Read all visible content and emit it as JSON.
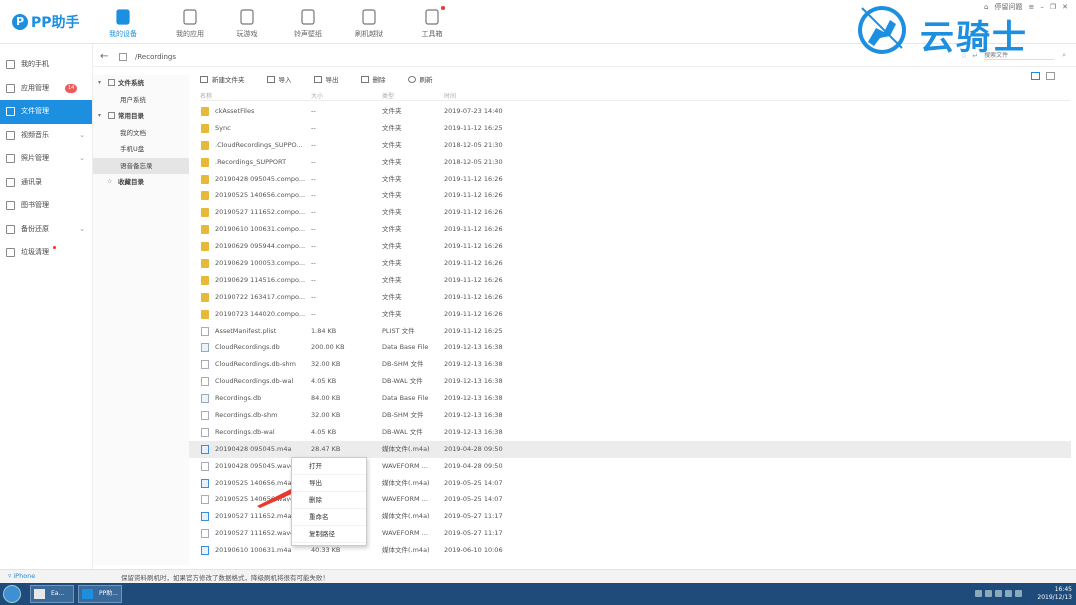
{
  "app": {
    "name": "PP助手"
  },
  "top_nav": [
    {
      "label": "我的设备",
      "icon": "device-icon",
      "active": true
    },
    {
      "label": "我的应用",
      "icon": "apps-icon",
      "active": false
    },
    {
      "label": "玩游戏",
      "icon": "gamepad-icon",
      "active": false
    },
    {
      "label": "铃声壁纸",
      "icon": "ringtone-icon",
      "active": false
    },
    {
      "label": "刷机越狱",
      "icon": "refresh-icon",
      "active": false
    },
    {
      "label": "工具箱",
      "icon": "toolbox-icon",
      "active": false,
      "dot": true
    }
  ],
  "window_controls": {
    "feedback": "停留问题"
  },
  "watermark": {
    "text": "云骑士"
  },
  "sidebar": [
    {
      "label": "我的手机",
      "icon": "phone-icon"
    },
    {
      "label": "应用管理",
      "icon": "app-icon",
      "badge": "14"
    },
    {
      "label": "文件管理",
      "icon": "file-icon",
      "active": true
    },
    {
      "label": "视频音乐",
      "icon": "video-icon",
      "chevron": true
    },
    {
      "label": "照片管理",
      "icon": "photo-icon",
      "chevron": true
    },
    {
      "label": "通讯录",
      "icon": "contacts-icon"
    },
    {
      "label": "图书管理",
      "icon": "book-icon"
    },
    {
      "label": "备份还原",
      "icon": "backup-icon",
      "chevron": true
    },
    {
      "label": "垃圾清理",
      "icon": "trash-icon",
      "dot": true
    }
  ],
  "path": {
    "current": "/Recordings",
    "search_placeholder": "搜索文件"
  },
  "tree": [
    {
      "label": "文件系统",
      "level": 0,
      "twisty": "▾"
    },
    {
      "label": "用户系统",
      "level": 1
    },
    {
      "label": "常用目录",
      "level": 0,
      "twisty": "▾"
    },
    {
      "label": "我的文档",
      "level": 1
    },
    {
      "label": "手机U盘",
      "level": 1
    },
    {
      "label": "语音备忘录",
      "level": 1,
      "active": true
    },
    {
      "label": "收藏目录",
      "level": 0,
      "star": true
    }
  ],
  "toolbar": {
    "new_folder": "新建文件夹",
    "import": "导入",
    "export": "导出",
    "delete": "删除",
    "refresh": "刷新"
  },
  "columns": {
    "name": "名称",
    "size": "大小",
    "type": "类型",
    "time": "时间"
  },
  "files": [
    {
      "name": "ckAssetFiles",
      "size": "--",
      "type": "文件夹",
      "time": "2019-07-23 14:40",
      "icon": "folder"
    },
    {
      "name": "Sync",
      "size": "--",
      "type": "文件夹",
      "time": "2019-11-12 16:25",
      "icon": "folder"
    },
    {
      "name": ".CloudRecordings_SUPPO...",
      "size": "--",
      "type": "文件夹",
      "time": "2018-12-05 21:30",
      "icon": "folder"
    },
    {
      "name": ".Recordings_SUPPORT",
      "size": "--",
      "type": "文件夹",
      "time": "2018-12-05 21:30",
      "icon": "folder"
    },
    {
      "name": "20190428 095045.compo...",
      "size": "--",
      "type": "文件夹",
      "time": "2019-11-12 16:26",
      "icon": "folder"
    },
    {
      "name": "20190525 140656.compo...",
      "size": "--",
      "type": "文件夹",
      "time": "2019-11-12 16:26",
      "icon": "folder"
    },
    {
      "name": "20190527 111652.compo...",
      "size": "--",
      "type": "文件夹",
      "time": "2019-11-12 16:26",
      "icon": "folder"
    },
    {
      "name": "20190610 100631.compo...",
      "size": "--",
      "type": "文件夹",
      "time": "2019-11-12 16:26",
      "icon": "folder"
    },
    {
      "name": "20190629 095944.compo...",
      "size": "--",
      "type": "文件夹",
      "time": "2019-11-12 16:26",
      "icon": "folder"
    },
    {
      "name": "20190629 100053.compo...",
      "size": "--",
      "type": "文件夹",
      "time": "2019-11-12 16:26",
      "icon": "folder"
    },
    {
      "name": "20190629 114516.compo...",
      "size": "--",
      "type": "文件夹",
      "time": "2019-11-12 16:26",
      "icon": "folder"
    },
    {
      "name": "20190722 163417.compo...",
      "size": "--",
      "type": "文件夹",
      "time": "2019-11-12 16:26",
      "icon": "folder"
    },
    {
      "name": "20190723 144020.compo...",
      "size": "--",
      "type": "文件夹",
      "time": "2019-11-12 16:26",
      "icon": "folder"
    },
    {
      "name": "AssetManifest.plist",
      "size": "1.84 KB",
      "type": "PLIST 文件",
      "time": "2019-11-12 16:25",
      "icon": "file"
    },
    {
      "name": "CloudRecordings.db",
      "size": "200.00 KB",
      "type": "Data Base File",
      "time": "2019-12-13 16:38",
      "icon": "db"
    },
    {
      "name": "CloudRecordings.db-shm",
      "size": "32.00 KB",
      "type": "DB-SHM 文件",
      "time": "2019-12-13 16:38",
      "icon": "file"
    },
    {
      "name": "CloudRecordings.db-wal",
      "size": "4.05 KB",
      "type": "DB-WAL 文件",
      "time": "2019-12-13 16:38",
      "icon": "file"
    },
    {
      "name": "Recordings.db",
      "size": "84.00 KB",
      "type": "Data Base File",
      "time": "2019-12-13 16:38",
      "icon": "db"
    },
    {
      "name": "Recordings.db-shm",
      "size": "32.00 KB",
      "type": "DB-SHM 文件",
      "time": "2019-12-13 16:38",
      "icon": "file"
    },
    {
      "name": "Recordings.db-wal",
      "size": "4.05 KB",
      "type": "DB-WAL 文件",
      "time": "2019-12-13 16:38",
      "icon": "file"
    },
    {
      "name": "20190428 095045.m4a",
      "size": "28.47 KB",
      "type": "媒体文件(.m4a)",
      "time": "2019-04-28 09:50",
      "icon": "audio",
      "highlight": true
    },
    {
      "name": "20190428 095045.wave",
      "size": "",
      "type": "WAVEFORM ...",
      "time": "2019-04-28 09:50",
      "icon": "file"
    },
    {
      "name": "20190525 140656.m4a",
      "size": "",
      "type": "媒体文件(.m4a)",
      "time": "2019-05-25 14:07",
      "icon": "audio"
    },
    {
      "name": "20190525 140656.wave",
      "size": "",
      "type": "WAVEFORM ...",
      "time": "2019-05-25 14:07",
      "icon": "file"
    },
    {
      "name": "20190527 111652.m4a",
      "size": "",
      "type": "媒体文件(.m4a)",
      "time": "2019-05-27 11:17",
      "icon": "audio"
    },
    {
      "name": "20190527 111652.wave",
      "size": "",
      "type": "WAVEFORM ...",
      "time": "2019-05-27 11:17",
      "icon": "file"
    },
    {
      "name": "20190610 100631.m4a",
      "size": "40.33 KB",
      "type": "媒体文件(.m4a)",
      "time": "2019-06-10 10:06",
      "icon": "audio"
    }
  ],
  "context_menu": [
    "打开",
    "导出",
    "删除",
    "重命名",
    "复制路径"
  ],
  "status": {
    "device": "iPhone",
    "message": "保留资料刷机时，如果官方修改了数据格式，降级刷机将很有可能失败！"
  },
  "taskbar": {
    "tasks": [
      "Ea...",
      "PP助..."
    ],
    "time": "16:45",
    "date": "2019/12/13"
  },
  "colors": {
    "accent": "#1c8fe0",
    "badge": "#f25a5a",
    "arrow": "#e8392f"
  }
}
